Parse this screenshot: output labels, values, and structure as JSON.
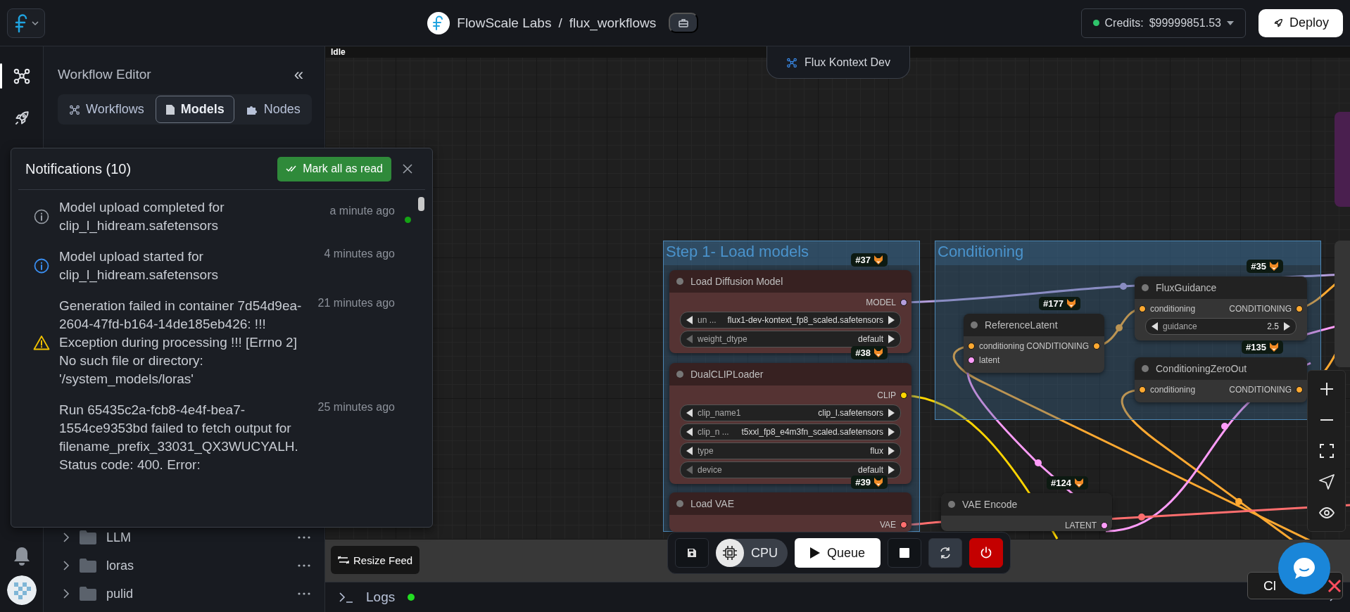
{
  "top_bar": {
    "org": "FlowScale Labs",
    "separator": "/",
    "project": "flux_workflows",
    "credits_label": "Credits:",
    "credits_value": "$99999851.53",
    "deploy": "Deploy"
  },
  "rail": [
    {
      "kind": "graph",
      "selected": true
    },
    {
      "kind": "rocket",
      "selected": false
    }
  ],
  "sidebar": {
    "title": "Workflow Editor",
    "collapse": "«",
    "tabs": [
      {
        "label": "Workflows",
        "kind": "graph",
        "selected": false
      },
      {
        "label": "Models",
        "kind": "file",
        "selected": true
      },
      {
        "label": "Nodes",
        "kind": "puzzle",
        "selected": false
      }
    ],
    "folders": [
      {
        "name": "LLM"
      },
      {
        "name": "loras"
      },
      {
        "name": "pulid"
      }
    ]
  },
  "notifications": {
    "title": "Notifications (10)",
    "mark_all": "Mark all as read",
    "items": [
      {
        "kind": "completed",
        "unread": true,
        "text": "Model upload completed for clip_l_hidream.safetensors",
        "time": "a minute ago"
      },
      {
        "kind": "info",
        "unread": false,
        "text": "Model upload started for clip_l_hidream.safetensors",
        "time": "4 minutes ago"
      },
      {
        "kind": "warning",
        "unread": false,
        "text": "Generation failed in container 7d54d9ea-2604-47fd-b164-14de185eb426: !!! Exception during processing !!! [Errno 2] No such file or directory: '/system_models/loras'",
        "time": "21 minutes ago"
      },
      {
        "kind": "plain",
        "unread": false,
        "text": "Run 65435c2a-fcb8-4e4f-bea7-1554ce9353bd failed to fetch output for filename_prefix_33031_QX3WUCYALH. Status code: 400. Error:",
        "time": "25 minutes ago"
      }
    ]
  },
  "canvas": {
    "status": "Idle",
    "workflow": "Flux Kontext Dev",
    "groups": [
      {
        "title": "Step 1- Load models"
      },
      {
        "title": "Conditioning"
      }
    ],
    "nodes": [
      {
        "title": "Load Diffusion Model",
        "badge": "#37",
        "color": "#553333",
        "outputs": [
          {
            "name": "MODEL",
            "color": "#b39ddb"
          }
        ],
        "widgets": [
          {
            "label": "un ...",
            "value": "flux1-dev-kontext_fp8_scaled.safetensors",
            "at_start": false
          },
          {
            "label": "weight_dtype",
            "value": "default",
            "at_start": true
          }
        ]
      },
      {
        "title": "DualCLIPLoader",
        "badge": "#38",
        "color": "#553333",
        "outputs": [
          {
            "name": "CLIP",
            "color": "#ffd500"
          }
        ],
        "widgets": [
          {
            "label": "clip_name1",
            "value": "clip_l.safetensors",
            "at_start": false
          },
          {
            "label": "clip_n ...",
            "value": "t5xxl_fp8_e4m3fn_scaled.safetensors",
            "at_start": false
          },
          {
            "label": "type",
            "value": "flux",
            "at_start": false
          },
          {
            "label": "device",
            "value": "default",
            "at_start": true
          }
        ]
      },
      {
        "title": "Load VAE",
        "badge": "#39",
        "color": "#553333",
        "outputs": [
          {
            "name": "VAE",
            "color": "#ff6e6e"
          }
        ]
      },
      {
        "title": "ReferenceLatent",
        "badge": "#177",
        "color": "#353535",
        "inputs": [
          {
            "name": "conditioning",
            "color": "#ffa931"
          },
          {
            "name": "latent",
            "color": "#ff9cf9"
          }
        ],
        "outputs": [
          {
            "name": "CONDITIONING",
            "color": "#ffa931"
          }
        ]
      },
      {
        "title": "FluxGuidance",
        "badge": "#35",
        "color": "#353535",
        "inputs": [
          {
            "name": "conditioning",
            "color": "#ffa931"
          }
        ],
        "outputs": [
          {
            "name": "CONDITIONING",
            "color": "#ffa931"
          }
        ],
        "widgets": [
          {
            "label": "guidance",
            "value": "2.5",
            "at_start": false
          }
        ]
      },
      {
        "title": "ConditioningZeroOut",
        "badge": "#135",
        "color": "#353535",
        "inputs": [
          {
            "name": "conditioning",
            "color": "#ffa931"
          }
        ],
        "outputs": [
          {
            "name": "CONDITIONING",
            "color": "#ffa931"
          }
        ]
      },
      {
        "title": "VAE Encode",
        "badge": "#124",
        "color": "#353535",
        "outputs": [
          {
            "name": "LATENT",
            "color": "#ff9cf9"
          }
        ]
      }
    ],
    "toolbar": {
      "device": "CPU",
      "queue": "Queue"
    },
    "resize_feed": "Resize Feed",
    "close_label": "Cl"
  },
  "logs": {
    "label": "Logs",
    "live": true
  }
}
